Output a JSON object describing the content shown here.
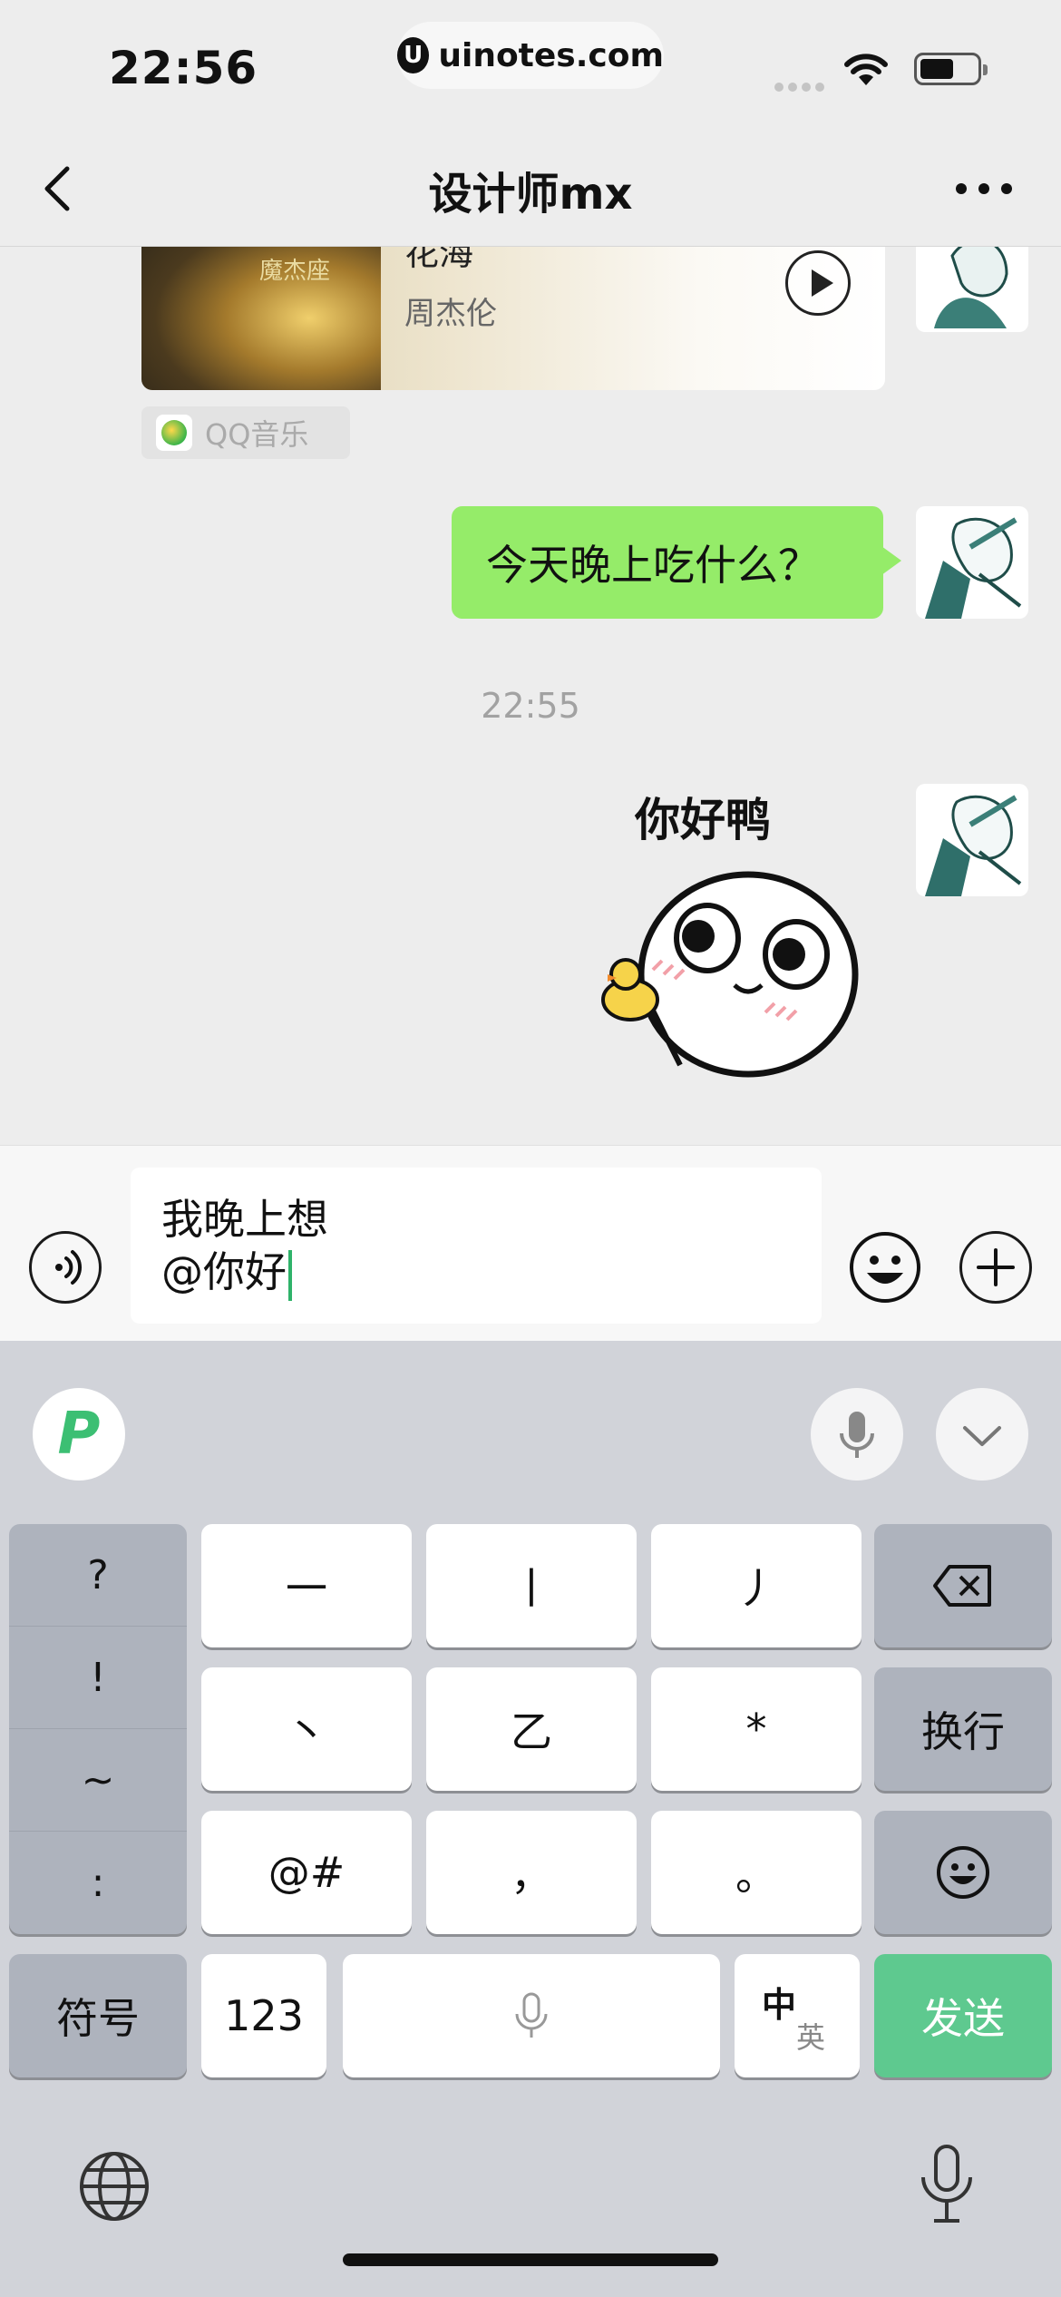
{
  "status_bar": {
    "time": "22:56",
    "url": "uinotes.com",
    "url_logo_letter": "U"
  },
  "nav": {
    "title": "设计师mx",
    "back_icon": "chevron-left-icon",
    "more_icon": "more-dots-icon"
  },
  "chat": {
    "music_card": {
      "song_title": "花海",
      "artist": "周杰伦",
      "album_text": "魔杰座",
      "source": "QQ音乐"
    },
    "sent_text": "今天晚上吃什么？",
    "timestamp": "22:55",
    "sticker_text": "你好鸭"
  },
  "input": {
    "line1": "我晚上想",
    "line2": "@你好"
  },
  "keyboard": {
    "punctuation": [
      "?",
      "!",
      "~",
      ":"
    ],
    "row1": [
      "一",
      "丨",
      "丿"
    ],
    "row2": [
      "丶",
      "乙",
      "*"
    ],
    "row3": [
      "@#",
      "，",
      "。"
    ],
    "return_label": "换行",
    "symbols_label": "符号",
    "numbers_label": "123",
    "lang_primary": "中",
    "lang_secondary": "英",
    "send_label": "发送"
  },
  "colors": {
    "bubble": "#95ec69",
    "send": "#5ec98f",
    "accent": "#2fb36a"
  }
}
